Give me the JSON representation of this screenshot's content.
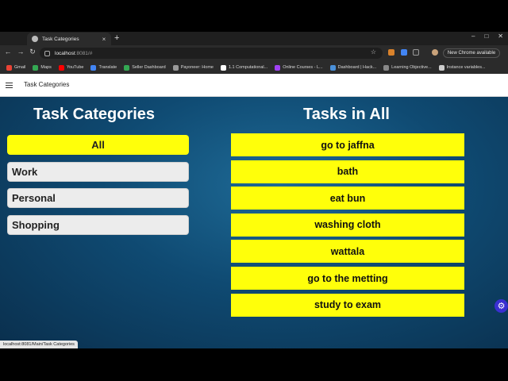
{
  "browser": {
    "tab_title": "Task Categories",
    "new_tab_glyph": "+",
    "close_glyph": "×",
    "url_host": "localhost",
    "url_path": ":8081/#",
    "new_chrome_label": "New Chrome available",
    "bookmarks": [
      {
        "label": "Gmail",
        "color": "#ea4335"
      },
      {
        "label": "Maps",
        "color": "#34a853"
      },
      {
        "label": "YouTube",
        "color": "#ff0000"
      },
      {
        "label": "Translate",
        "color": "#4285f4"
      },
      {
        "label": "Seller Dashboard",
        "color": "#34a853"
      },
      {
        "label": "Payoneer: Home",
        "color": "#999999"
      },
      {
        "label": "1.1 Computational...",
        "color": "#ffffff"
      },
      {
        "label": "Online Courses - L...",
        "color": "#a142f4"
      },
      {
        "label": "Dashboard | Hack...",
        "color": "#4a90d9"
      },
      {
        "label": "Learning Objective...",
        "color": "#888888"
      },
      {
        "label": "Instance variables...",
        "color": "#cccccc"
      }
    ],
    "status_url": "localhost:8081/Main/Task Categories"
  },
  "app": {
    "title": "Task Categories",
    "categories_heading": "Task Categories",
    "tasks_heading": "Tasks in All",
    "categories": [
      {
        "label": "All",
        "active": true
      },
      {
        "label": "Work",
        "active": false
      },
      {
        "label": "Personal",
        "active": false
      },
      {
        "label": "Shopping",
        "active": false
      }
    ],
    "tasks": [
      "go to jaffna",
      "bath",
      "eat bun",
      "washing cloth",
      "wattala",
      "go to the metting",
      "study to exam"
    ],
    "fab_icon": "gear-icon",
    "colors": {
      "accent_yellow": "#ffff0a",
      "background_blue": "#0f4a72",
      "fab": "#3a2fd1"
    }
  }
}
